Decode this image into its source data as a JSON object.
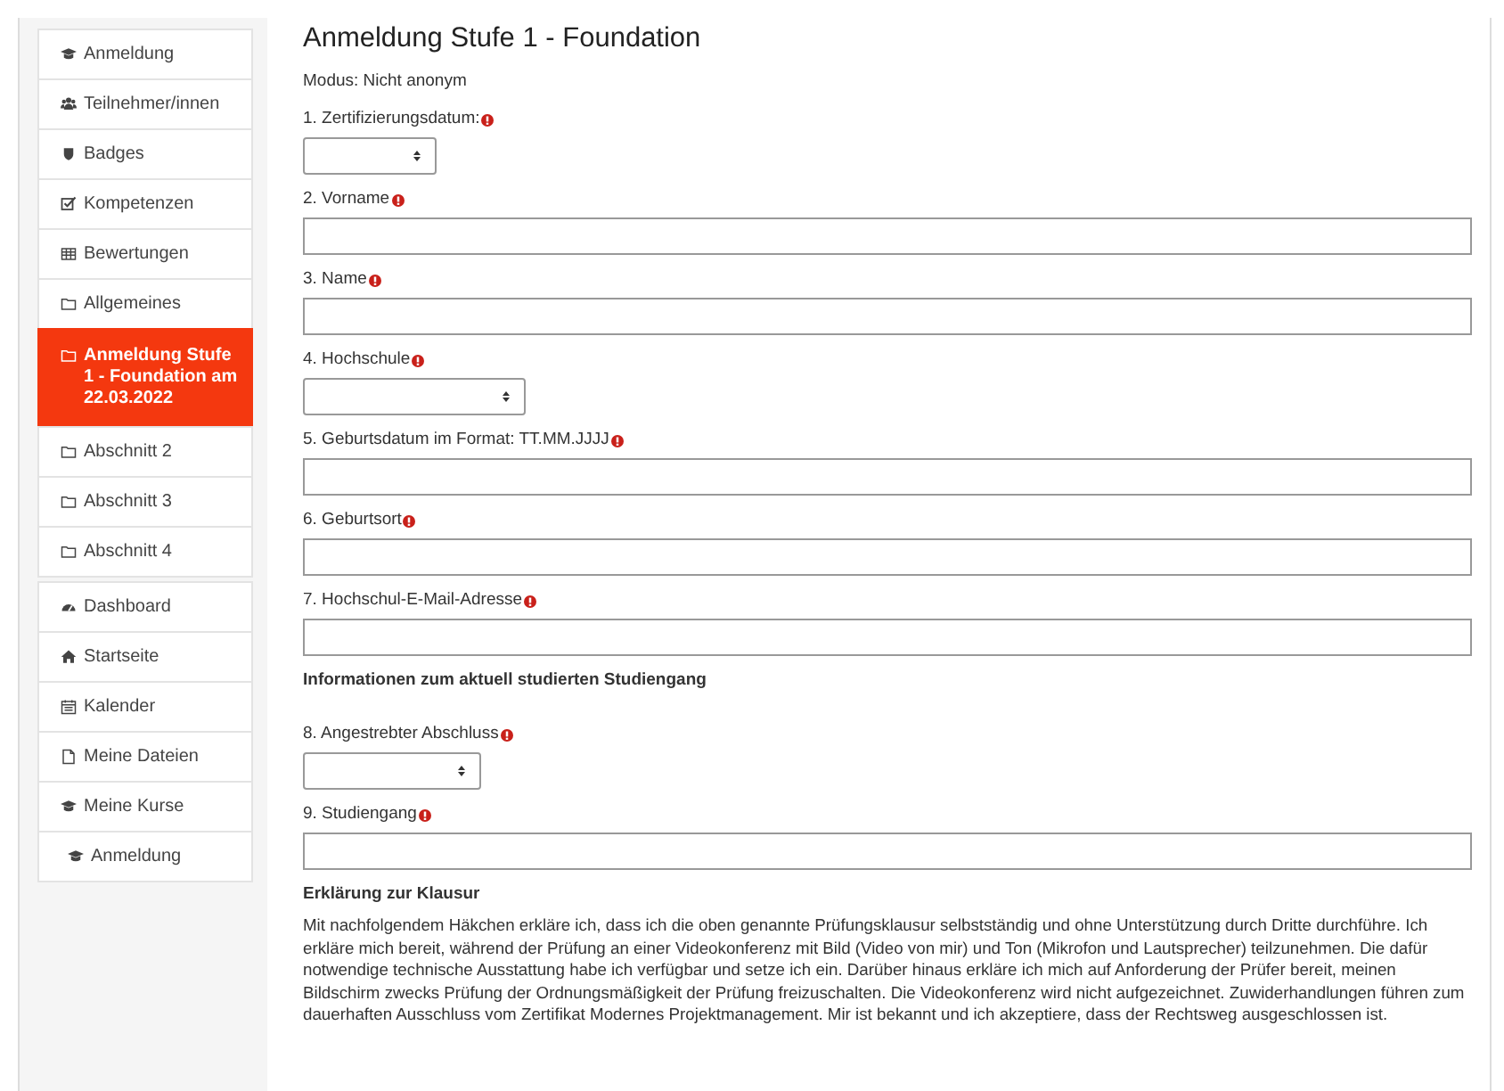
{
  "sidebar": {
    "groups": [
      {
        "items": [
          {
            "label": "Anmeldung",
            "kind": "course",
            "selected": false
          },
          {
            "label": "Teilnehmer/innen",
            "kind": "users",
            "selected": false
          },
          {
            "label": "Badges",
            "kind": "badge",
            "selected": false
          },
          {
            "label": "Kompetenzen",
            "kind": "check",
            "selected": false
          },
          {
            "label": "Bewertungen",
            "kind": "grid",
            "selected": false
          },
          {
            "label": "Allgemeines",
            "kind": "folder",
            "selected": false
          },
          {
            "label": "Anmeldung Stufe 1 - Foundation am 22.03.2022",
            "kind": "folder",
            "selected": true
          },
          {
            "label": "Abschnitt 2",
            "kind": "folder",
            "selected": false
          },
          {
            "label": "Abschnitt 3",
            "kind": "folder",
            "selected": false
          },
          {
            "label": "Abschnitt 4",
            "kind": "folder",
            "selected": false
          }
        ]
      },
      {
        "items": [
          {
            "label": "Dashboard",
            "kind": "dashboard",
            "selected": false
          },
          {
            "label": "Startseite",
            "kind": "home",
            "selected": false
          },
          {
            "label": "Kalender",
            "kind": "calendar",
            "selected": false
          },
          {
            "label": "Meine Dateien",
            "kind": "file",
            "selected": false
          },
          {
            "label": "Meine Kurse",
            "kind": "course",
            "selected": false
          },
          {
            "label": "Anmeldung",
            "kind": "course",
            "selected": false
          }
        ]
      }
    ]
  },
  "form": {
    "title": "Anmeldung Stufe 1 - Foundation",
    "mode": "Modus: Nicht anonym",
    "blocks": [
      {
        "kind": "select",
        "label": "1. Zertifizierungsdatum:",
        "required": true
      },
      {
        "kind": "input",
        "label": "2. Vorname",
        "required": true
      },
      {
        "kind": "input",
        "label": "3. Name",
        "required": true
      },
      {
        "kind": "select",
        "label": "4. Hochschule",
        "required": true
      },
      {
        "kind": "input",
        "label": "5. Geburtsdatum im Format: TT.MM.JJJJ",
        "required": true
      },
      {
        "kind": "input",
        "label": "6. Geburtsort",
        "required": true
      },
      {
        "kind": "input",
        "label": "7. Hochschul-E-Mail-Adresse",
        "required": true
      },
      {
        "kind": "heading",
        "text": "Informationen zum aktuell studierten Studiengang"
      },
      {
        "kind": "select",
        "label": "8. Angestrebter Abschluss",
        "required": true
      },
      {
        "kind": "input",
        "label": "9. Studiengang",
        "required": true
      },
      {
        "kind": "heading",
        "text": "Erklärung zur Klausur"
      },
      {
        "kind": "paragraph",
        "text": "Mit nachfolgendem Häkchen erkläre ich, dass ich die oben genannte Prüfungsklausur selbstständig und ohne Unterstützung durch Dritte durchführe. Ich erkläre mich bereit, während der Prüfung an einer Videokonferenz mit Bild (Video von mir) und Ton (Mikrofon und Lautsprecher) teilzunehmen. Die dafür notwendige technische Ausstattung habe ich verfügbar und setze ich ein. Darüber hinaus erkläre ich mich auf Anforderung der Prüfer bereit, meinen Bildschirm zwecks Prüfung der Ordnungsmäßigkeit der Prüfung freizuschalten. Die Videokonferenz wird nicht aufgezeichnet. Zuwiderhandlungen führen zum dauerhaften Ausschluss vom Zertifikat Modernes Projektmanagement. Mir ist bekannt und ich akzeptiere, dass der Rechtsweg ausgeschlossen ist."
      }
    ]
  }
}
